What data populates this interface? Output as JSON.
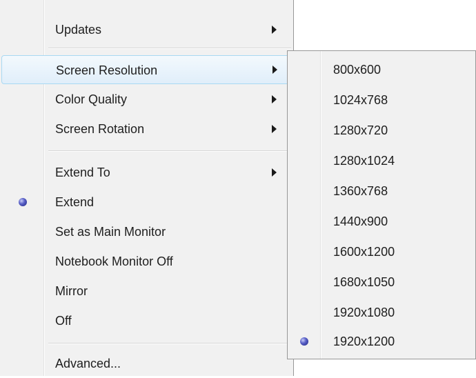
{
  "menu": {
    "items": [
      {
        "label": "Updates",
        "submenu": true
      },
      {
        "label": "Screen Resolution",
        "submenu": true,
        "highlighted": true
      },
      {
        "label": "Color Quality",
        "submenu": true
      },
      {
        "label": "Screen Rotation",
        "submenu": true
      },
      {
        "label": "Extend To",
        "submenu": true
      },
      {
        "label": "Extend",
        "selected": true
      },
      {
        "label": "Set as Main Monitor"
      },
      {
        "label": "Notebook Monitor Off"
      },
      {
        "label": "Mirror"
      },
      {
        "label": "Off"
      },
      {
        "label": "Advanced..."
      }
    ]
  },
  "submenu": {
    "items": [
      {
        "label": "800x600"
      },
      {
        "label": "1024x768"
      },
      {
        "label": "1280x720"
      },
      {
        "label": "1280x1024"
      },
      {
        "label": "1360x768"
      },
      {
        "label": "1440x900"
      },
      {
        "label": "1600x1200"
      },
      {
        "label": "1680x1050"
      },
      {
        "label": "1920x1080"
      },
      {
        "label": "1920x1200",
        "selected": true
      }
    ]
  },
  "colors": {
    "menu_background": "#f1f1f1",
    "highlight_border": "#a8d8f2",
    "radio_dot": "#3a40a8"
  },
  "icons": {
    "submenu_arrow": "chevron-right-icon",
    "selected_marker": "radio-dot-icon"
  }
}
